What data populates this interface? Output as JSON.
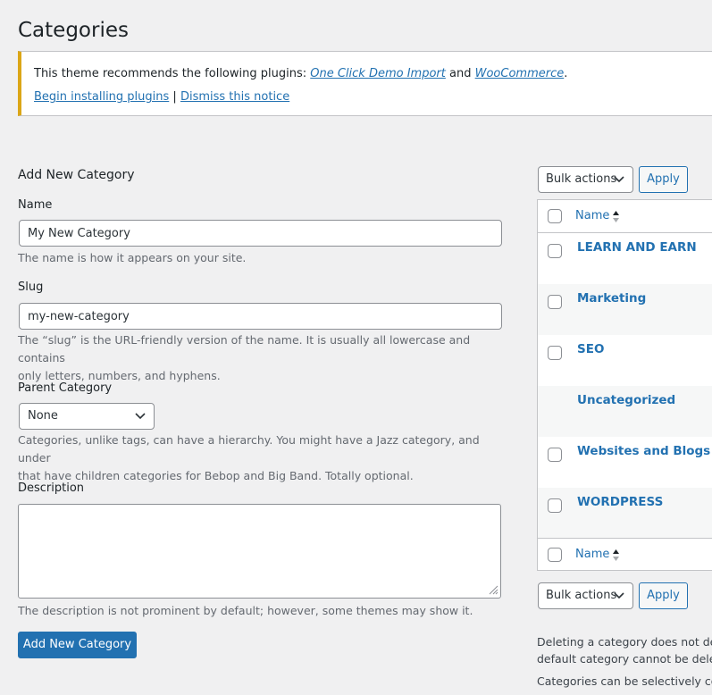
{
  "page": {
    "title": "Categories"
  },
  "notice": {
    "prefix": "This theme recommends the following plugins:",
    "plugin1": "One Click Demo Import",
    "and_text": "and",
    "plugin2": "WooCommerce",
    "period": ".",
    "begin_link": "Begin installing plugins",
    "separator": "|",
    "dismiss_link": "Dismiss this notice",
    "accent_color": "#dba617"
  },
  "form": {
    "heading": "Add New Category",
    "name_label": "Name",
    "name_value": "My New Category",
    "name_help": "The name is how it appears on your site.",
    "slug_label": "Slug",
    "slug_value": "my-new-category",
    "slug_help_1": "The “slug” is the URL-friendly version of the name. It is usually all lowercase and contains",
    "slug_help_2": "only letters, numbers, and hyphens.",
    "parent_label": "Parent Category",
    "parent_value": "None",
    "parent_help_1": "Categories, unlike tags, can have a hierarchy. You might have a Jazz category, and under",
    "parent_help_2": "that have children categories for Bebop and Big Band. Totally optional.",
    "description_label": "Description",
    "description_value": "",
    "description_help": "The description is not prominent by default; however, some themes may show it.",
    "submit_label": "Add New Category"
  },
  "list": {
    "bulk_label": "Bulk actions",
    "apply_label": "Apply",
    "column_name": "Name",
    "rows": [
      {
        "name": "LEARN AND EARN",
        "checkbox": true
      },
      {
        "name": "Marketing",
        "checkbox": true
      },
      {
        "name": "SEO",
        "checkbox": true
      },
      {
        "name": "Uncategorized",
        "checkbox": false
      },
      {
        "name": "Websites and Blogs",
        "checkbox": true
      },
      {
        "name": "WORDPRESS",
        "checkbox": true
      }
    ],
    "footnote_1": "Deleting a category does not dele",
    "footnote_2": "default category cannot be delete",
    "footnote_3": "Categories can be selectively conv"
  },
  "colors": {
    "primary": "#2271b1",
    "background": "#f0f0f1",
    "border": "#c3c4c7"
  },
  "icons": [
    "chevron-down-icon",
    "sort-icon",
    "resize-grip-icon"
  ]
}
